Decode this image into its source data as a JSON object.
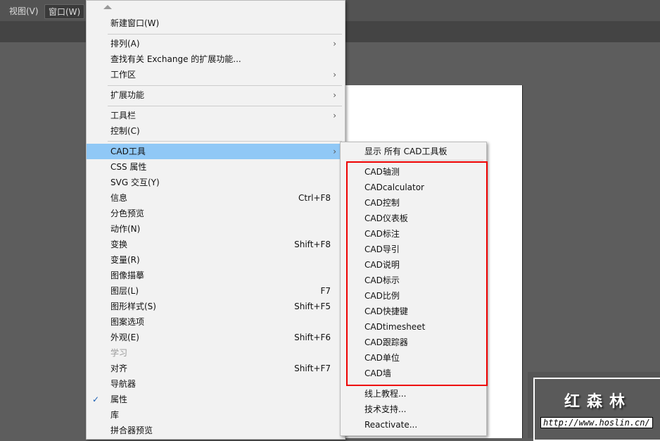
{
  "menubar": {
    "view": "视图(V)",
    "window": "窗口(W)"
  },
  "main_menu": [
    {
      "label": "新建窗口(W)"
    },
    {
      "label": "排列(A)",
      "sub": true
    },
    {
      "label": "查找有关 Exchange 的扩展功能..."
    },
    {
      "label": "工作区",
      "sub": true
    },
    {
      "label": "扩展功能",
      "sub": true
    },
    {
      "label": "工具栏",
      "sub": true
    },
    {
      "label": "控制(C)"
    },
    {
      "label": "CAD工具",
      "sub": true,
      "highlighted": true
    },
    {
      "label": "CSS 属性"
    },
    {
      "label": "SVG 交互(Y)"
    },
    {
      "label": "信息",
      "shortcut": "Ctrl+F8"
    },
    {
      "label": "分色预览"
    },
    {
      "label": "动作(N)"
    },
    {
      "label": "变换",
      "shortcut": "Shift+F8"
    },
    {
      "label": "变量(R)"
    },
    {
      "label": "图像描摹"
    },
    {
      "label": "图层(L)",
      "shortcut": "F7"
    },
    {
      "label": "图形样式(S)",
      "shortcut": "Shift+F5"
    },
    {
      "label": "图案选项"
    },
    {
      "label": "外观(E)",
      "shortcut": "Shift+F6"
    },
    {
      "label": "学习",
      "disabled": true
    },
    {
      "label": "对齐",
      "shortcut": "Shift+F7"
    },
    {
      "label": "导航器"
    },
    {
      "label": "属性",
      "checked": true
    },
    {
      "label": "库"
    },
    {
      "label": "拼合器预览"
    }
  ],
  "submenu": {
    "header": "显示 所有 CAD工具板",
    "cad_items": [
      "CAD轴测",
      "CADcalculator",
      "CAD控制",
      "CAD仪表板",
      "CAD标注",
      "CAD导引",
      "CAD说明",
      "CAD标示",
      "CAD比例",
      "CAD快捷键",
      "CADtimesheet",
      "CAD跟踪器",
      "CAD单位",
      "CAD墙"
    ],
    "footer": [
      "线上教程...",
      "技术支持...",
      "Reactivate..."
    ]
  },
  "watermark": {
    "title": "红森林",
    "url": "http://www.hoslin.cn/"
  }
}
